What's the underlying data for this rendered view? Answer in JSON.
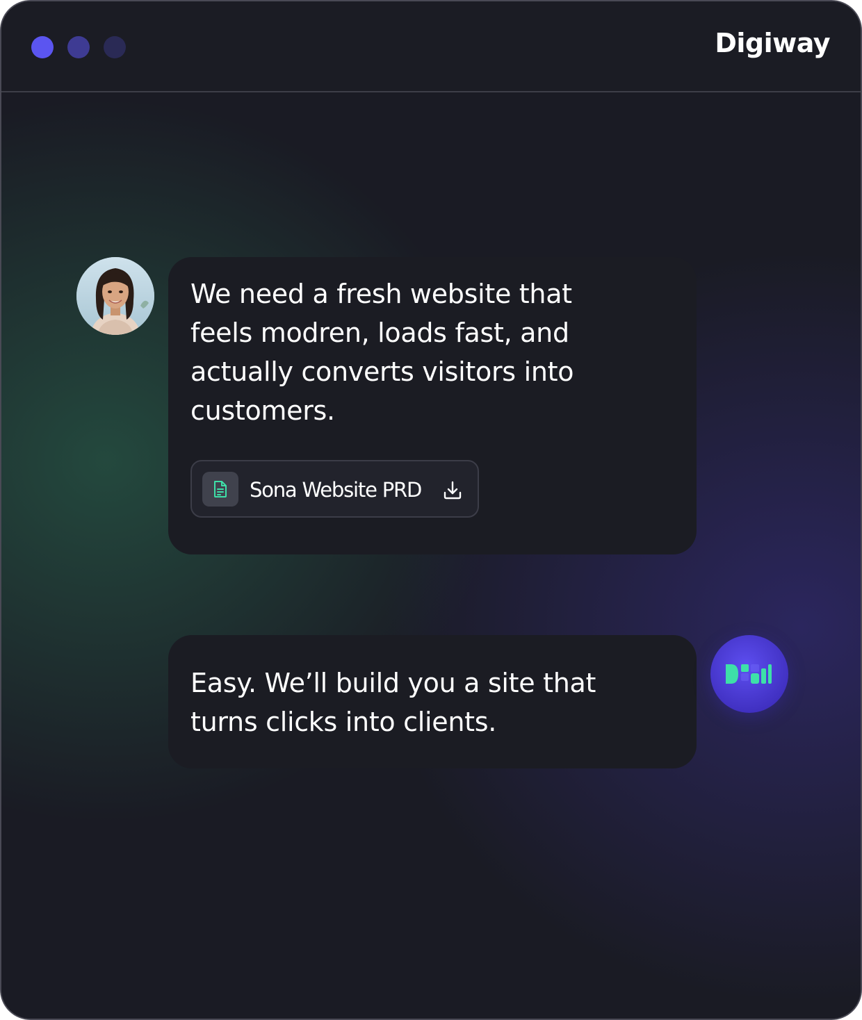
{
  "window": {
    "controls": [
      {
        "name": "close",
        "color": "#5b55f0"
      },
      {
        "name": "minimize",
        "color": "#3e3b93"
      },
      {
        "name": "maximize",
        "color": "#2a2a55"
      }
    ],
    "brand": "Digiway"
  },
  "chat": {
    "messages": [
      {
        "sender": "user",
        "avatar_icon": "user-photo-avatar",
        "text": "We need a fresh website that feels modren, loads fast, and actually converts visitors into customers.",
        "attachment": {
          "icon": "document-icon",
          "name": "Sona Website PRD",
          "action_icon": "download-icon"
        }
      },
      {
        "sender": "assistant",
        "avatar_icon": "digiway-logo-avatar",
        "text": "Easy. We’ll build you a site that turns clicks into clients."
      }
    ]
  },
  "colors": {
    "accent_green": "#3ee0a8",
    "accent_purple": "#5b4ef0",
    "bubble_bg": "#1b1c23"
  }
}
